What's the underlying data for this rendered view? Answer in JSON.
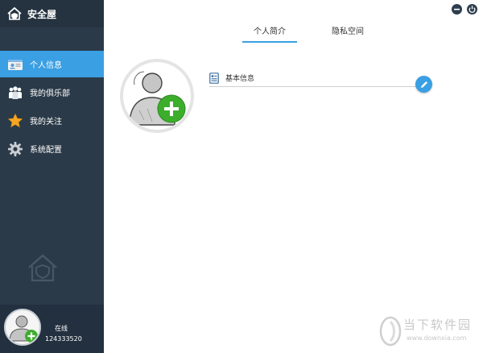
{
  "app": {
    "title": "安全屋"
  },
  "sidebar": {
    "items": [
      {
        "label": "个人信息",
        "icon": "profile-card-icon",
        "active": true
      },
      {
        "label": "我的俱乐部",
        "icon": "club-people-icon",
        "active": false
      },
      {
        "label": "我的关注",
        "icon": "star-icon",
        "active": false
      },
      {
        "label": "系统配置",
        "icon": "gear-icon",
        "active": false
      }
    ],
    "footer": {
      "status": "在线",
      "user_id": "124333520"
    }
  },
  "tabs": [
    {
      "label": "个人简介",
      "active": true
    },
    {
      "label": "隐私空间",
      "active": false
    }
  ],
  "profile": {
    "section_title": "基本信息"
  },
  "watermark": {
    "cn": "当下软件园",
    "en": "www.downxia.com"
  },
  "colors": {
    "sidebar": "#2b3a48",
    "accent": "#3a9fe3",
    "green": "#3cae2c"
  }
}
